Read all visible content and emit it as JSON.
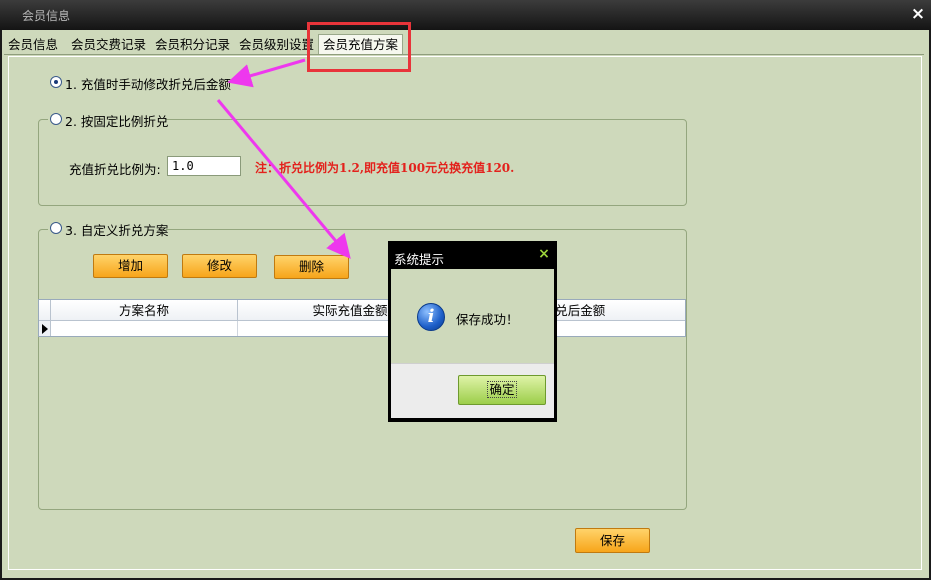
{
  "window": {
    "title": "会员信息",
    "close_symbol": "×"
  },
  "tabs": [
    {
      "label": "会员信息"
    },
    {
      "label": "会员交费记录"
    },
    {
      "label": "会员积分记录"
    },
    {
      "label": "会员级别设置"
    },
    {
      "label": "会员充值方案"
    }
  ],
  "options": {
    "opt1": {
      "label": "1. 充值时手动修改折兑后金额",
      "checked": true
    },
    "opt2": {
      "label": "2. 按固定比例折兑",
      "ratio_label": "充值折兑比例为:",
      "ratio_value": "1.0",
      "note": "注：折兑比例为1.2,即充值100元兑换充值120."
    },
    "opt3": {
      "label": "3. 自定义折兑方案",
      "buttons": {
        "add": "增加",
        "edit": "修改",
        "delete": "删除"
      },
      "grid": {
        "columns": [
          "方案名称",
          "实际充值金额",
          "折兑后金额"
        ],
        "rows": [
          [
            "",
            "",
            ""
          ]
        ]
      }
    }
  },
  "save_label": "保存",
  "dialog": {
    "title": "系统提示",
    "close_symbol": "×",
    "icon_glyph": "i",
    "message": "保存成功！",
    "ok_label": "确定"
  },
  "colors": {
    "panel_bg": "#ced9bb",
    "titlebar_bg": "#1c1c1c",
    "button_orange": "#f7a51a",
    "note_red": "#e3211c",
    "annotation_magenta": "#ee38ee",
    "highlight_red": "#e8343a"
  }
}
